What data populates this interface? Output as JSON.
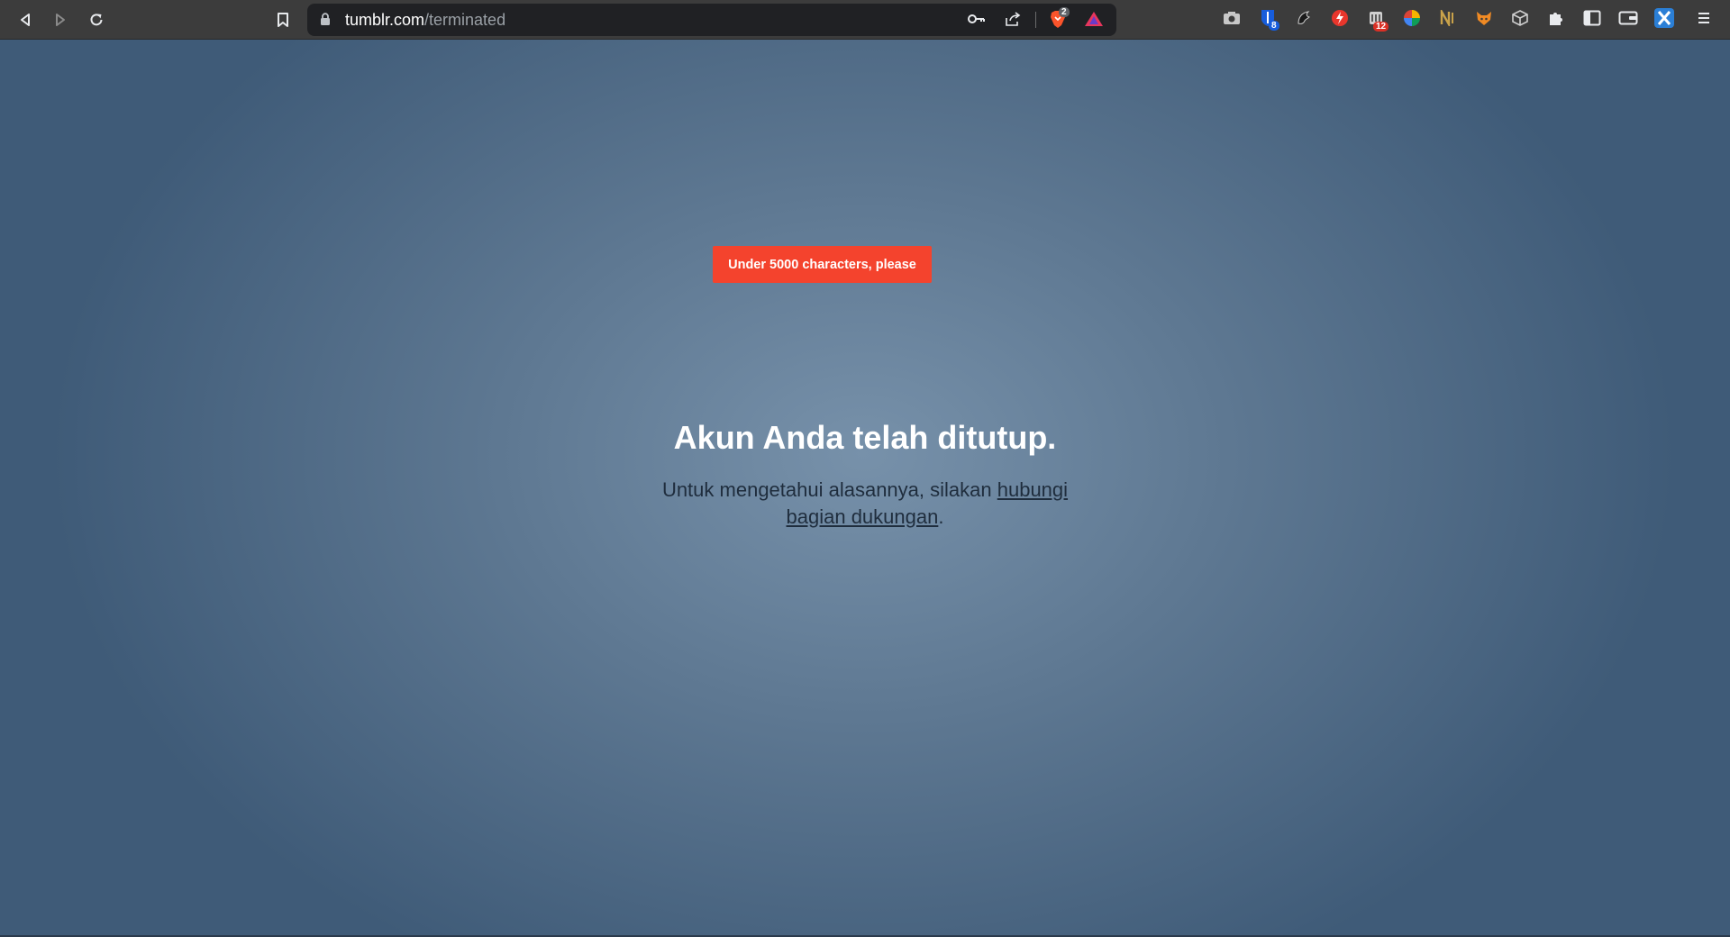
{
  "browser": {
    "url_host": "tumblr.com",
    "url_path": "/terminated",
    "brave_shield_count": "2",
    "extension_badges": {
      "bitwarden": "8",
      "reader": "12"
    },
    "icons": {
      "back": "back-arrow-icon",
      "forward": "forward-arrow-icon",
      "reload": "reload-icon",
      "bookmark": "bookmark-icon",
      "lock": "lock-icon",
      "key": "key-icon",
      "share": "share-icon",
      "brave": "brave-shields-icon",
      "rewards": "brave-rewards-icon",
      "extensions": [
        "camera-extension-icon",
        "bitwarden-extension-icon",
        "wolf-extension-icon",
        "bolt-extension-icon",
        "reader-extension-icon",
        "color-wheel-extension-icon",
        "n-extension-icon",
        "fox-extension-icon",
        "cube-extension-icon",
        "puzzle-extensions-icon",
        "sidebar-icon",
        "wallet-icon",
        "x-extension-icon",
        "menu-icon"
      ]
    }
  },
  "colors": {
    "toast_background": "#f4432d",
    "page_background": "#5e7892"
  },
  "toast": {
    "text": "Under 5000 characters, please"
  },
  "main": {
    "headline": "Akun Anda telah ditutup.",
    "message_prefix": "Untuk mengetahui alasannya, silakan ",
    "message_link": "hubungi bagian dukungan",
    "message_suffix": "."
  }
}
